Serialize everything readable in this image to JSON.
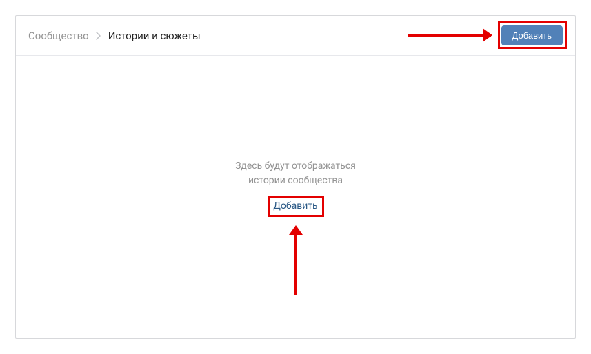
{
  "breadcrumb": {
    "parent": "Сообщество",
    "current": "Истории и сюжеты"
  },
  "header": {
    "add_button": "Добавить"
  },
  "empty_state": {
    "line1": "Здесь будут отображаться",
    "line2": "истории сообщества",
    "add_link": "Добавить"
  }
}
